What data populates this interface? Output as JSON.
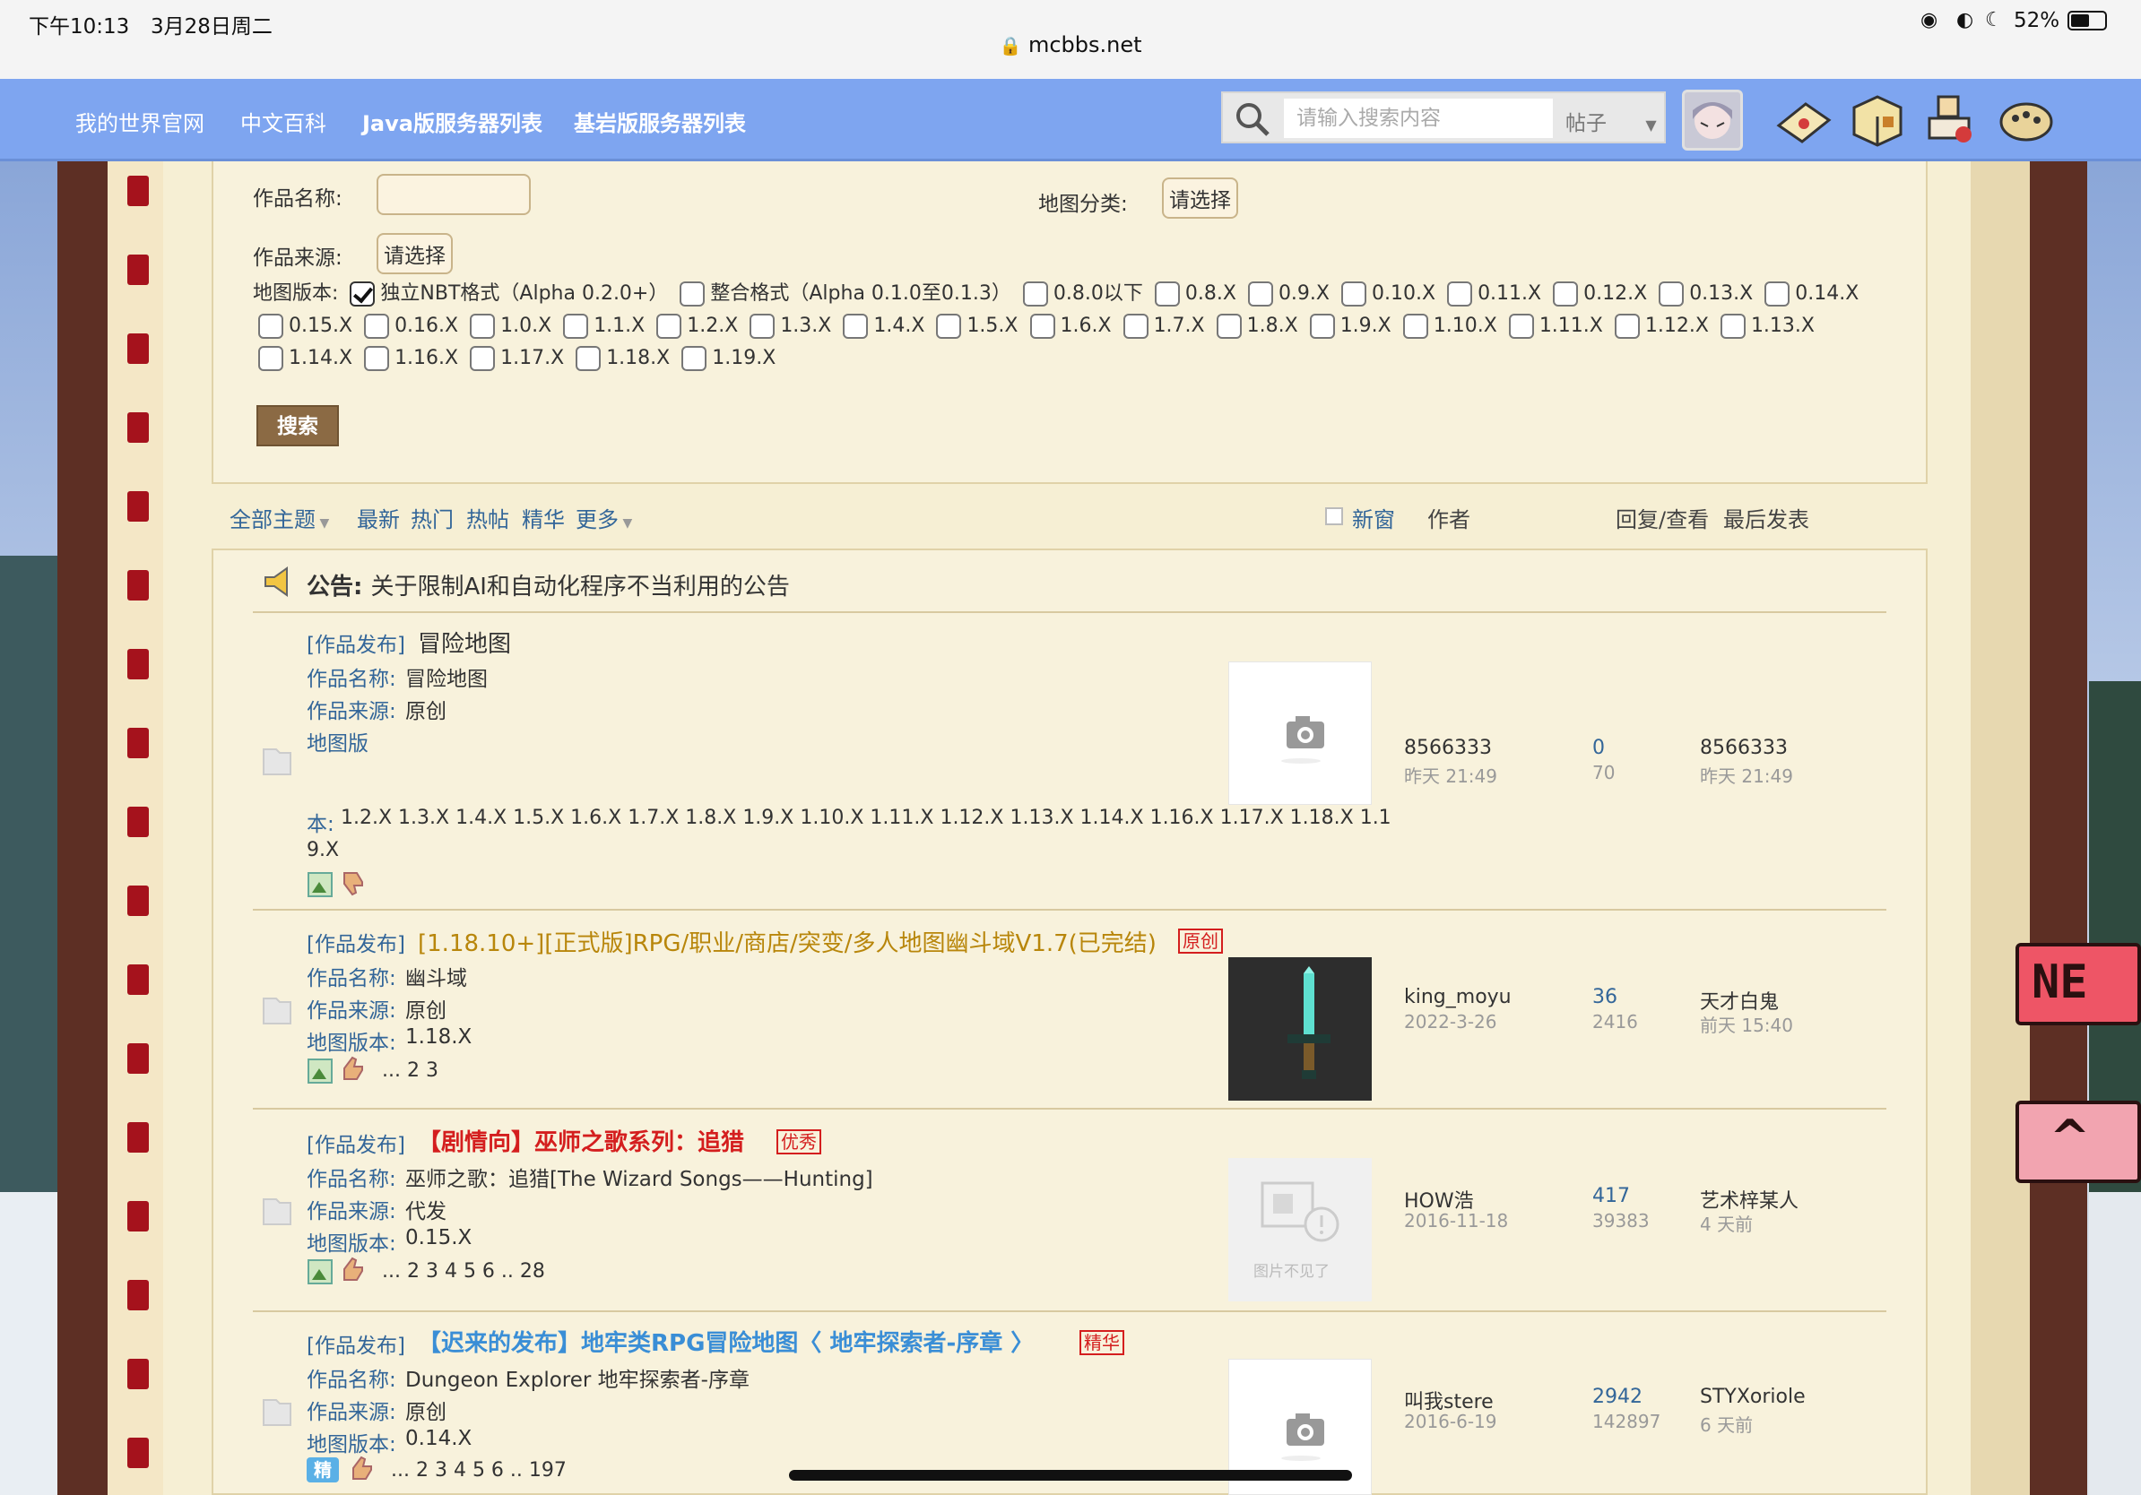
{
  "status": {
    "time": "下午10:13",
    "date": "3月28日周二",
    "battery": "52%"
  },
  "browser": {
    "url": "mcbbs.net"
  },
  "nav": {
    "links": [
      "我的世界官网",
      "中文百科",
      "Java版服务器列表",
      "基岩版服务器列表"
    ],
    "search_placeholder": "请输入搜索内容",
    "search_type": "帖子"
  },
  "form": {
    "name_label": "作品名称:",
    "source_label": "作品来源:",
    "source_select": "请选择",
    "category_label": "地图分类:",
    "category_select": "请选择",
    "version_label": "地图版本:",
    "versions": [
      "独立NBT格式（Alpha 0.2.0+）",
      "整合格式（Alpha 0.1.0至0.1.3）",
      "0.8.0以下",
      "0.8.X",
      "0.9.X",
      "0.10.X",
      "0.11.X",
      "0.12.X",
      "0.13.X",
      "0.14.X",
      "0.15.X",
      "0.16.X",
      "1.0.X",
      "1.1.X",
      "1.2.X",
      "1.3.X",
      "1.4.X",
      "1.5.X",
      "1.6.X",
      "1.7.X",
      "1.8.X",
      "1.9.X",
      "1.10.X",
      "1.11.X",
      "1.12.X",
      "1.13.X",
      "1.14.X",
      "1.16.X",
      "1.17.X",
      "1.18.X",
      "1.19.X"
    ],
    "checked_index": 0,
    "search_button": "搜索"
  },
  "filters": {
    "all": "全部主题",
    "latest": "最新",
    "hot": "热门",
    "hotpost": "热帖",
    "digest": "精华",
    "more": "更多",
    "newwin": "新窗",
    "author": "作者",
    "replies": "回复/查看",
    "lastpost": "最后发表"
  },
  "announcement": {
    "prefix": "公告:",
    "text": "关于限制AI和自动化程序不当利用的公告"
  },
  "labels": {
    "name": "作品名称:",
    "source": "作品来源:",
    "version": "地图版本:"
  },
  "threads": [
    {
      "tag": "[作品发布]",
      "title": "冒险地图",
      "title_color": "#333333",
      "badge": "",
      "name": "冒险地图",
      "source": "原创",
      "version_prefix": "地图版",
      "version_line1_label": "本:",
      "version_line1": "1.2.X 1.3.X 1.4.X 1.5.X 1.6.X 1.7.X 1.8.X 1.9.X 1.10.X 1.11.X 1.12.X 1.13.X 1.14.X 1.16.X 1.17.X 1.18.X 1.1",
      "version_line2": "9.X",
      "thumb": "camera-placeholder",
      "author": "8566333",
      "date": "昨天 21:49",
      "replies": "0",
      "views": "70",
      "last_user": "8566333",
      "last_time": "昨天 21:49",
      "pages": ""
    },
    {
      "tag": "[作品发布]",
      "title": "[1.18.10+][正式版]RPG/职业/商店/突变/多人地图幽斗域V1.7(已完结)",
      "title_color": "#b8860b",
      "badge": "原创",
      "name": "幽斗域",
      "source": "原创",
      "version": "1.18.X",
      "thumb": "diamond-sword",
      "author": "king_moyu",
      "date": "2022-3-26",
      "replies": "36",
      "views": "2416",
      "last_user": "天才白鬼",
      "last_time": "前天 15:40",
      "pages": "... 2  3"
    },
    {
      "tag": "[作品发布]",
      "title": "【剧情向】巫师之歌系列：追猎",
      "title_color": "#d41e1e",
      "badge": "优秀",
      "name": "巫师之歌：追猎[The Wizard Songs——Hunting]",
      "source": "代发",
      "version": "0.15.X",
      "thumb": "image-missing",
      "thumb_text": "图片不见了",
      "author": "HOW浩",
      "date": "2016-11-18",
      "replies": "417",
      "views": "39383",
      "last_user": "艺术梓某人",
      "last_time": "4 天前",
      "pages": "... 2  3  4  5  6 .. 28"
    },
    {
      "tag": "[作品发布]",
      "title": "【迟来的发布】地牢类RPG冒险地图〈 地牢探索者-序章 〉",
      "title_color": "#3a8ed6",
      "badge": "精华",
      "name": "Dungeon Explorer 地牢探索者-序章",
      "source": "原创",
      "version": "0.14.X",
      "thumb": "camera-placeholder",
      "digest_icon": "精",
      "author": "叫我stere",
      "date": "2016-6-19",
      "replies": "2942",
      "views": "142897",
      "last_user": "STYXoriole",
      "last_time": "6 天前",
      "pages": "... 2  3  4  5  6 .. 197"
    }
  ],
  "colors": {
    "nav": "#7ea5f0",
    "panel": "#f6efd4",
    "link": "#336699",
    "red": "#d41e1e",
    "border_wood": "#5d2f24"
  }
}
